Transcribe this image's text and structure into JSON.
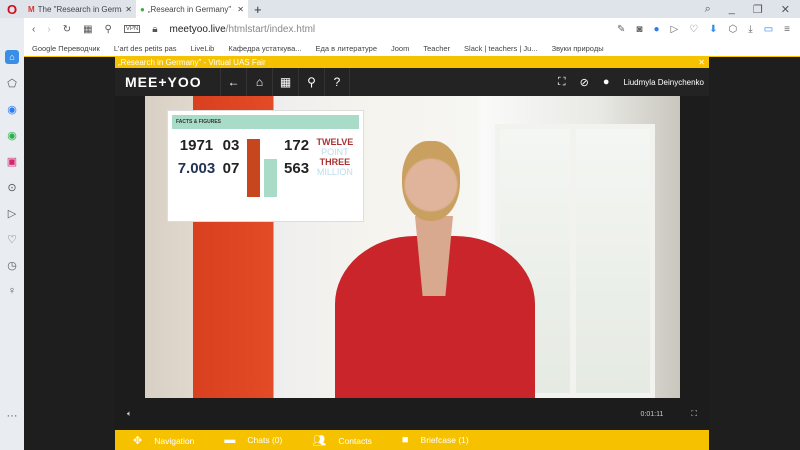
{
  "browser": {
    "tabs": [
      {
        "label": "The \"Research in Germany\"",
        "icon": "gmail-icon"
      },
      {
        "label": "„Research in Germany\" - Vi",
        "icon": "meetyoo-icon"
      }
    ],
    "url_host": "meetyoo.live",
    "url_path": "/htmlstart/index.html",
    "vpn": "VPN",
    "bookmarks": [
      "Google Переводчик",
      "L'art des petits pas",
      "LiveLib",
      "Кафедра устаткува...",
      "Еда в литературе",
      "Joom",
      "Teacher",
      "Slack | teachers | Ju...",
      "Звуки природы"
    ]
  },
  "app": {
    "banner": "„Research in Germany\" - Virtual UAS Fair",
    "brand": "MEE+YOO",
    "user": "Liudmyla Deinychenko",
    "slide": {
      "title": "FACTS & FIGURES",
      "n1": "1971",
      "n2": "7.003",
      "n3": "03",
      "n4": "07",
      "n5": "172",
      "n6": "563",
      "w1": "TWELVE",
      "w2": "POINT",
      "w3": "THREE",
      "w4": "MILLION"
    },
    "time": "0:01:11",
    "bottom": {
      "navigation": "Navigation",
      "chats": "Chats (0)",
      "contacts": "Contacts",
      "briefcase": "Briefcase (1)"
    }
  }
}
